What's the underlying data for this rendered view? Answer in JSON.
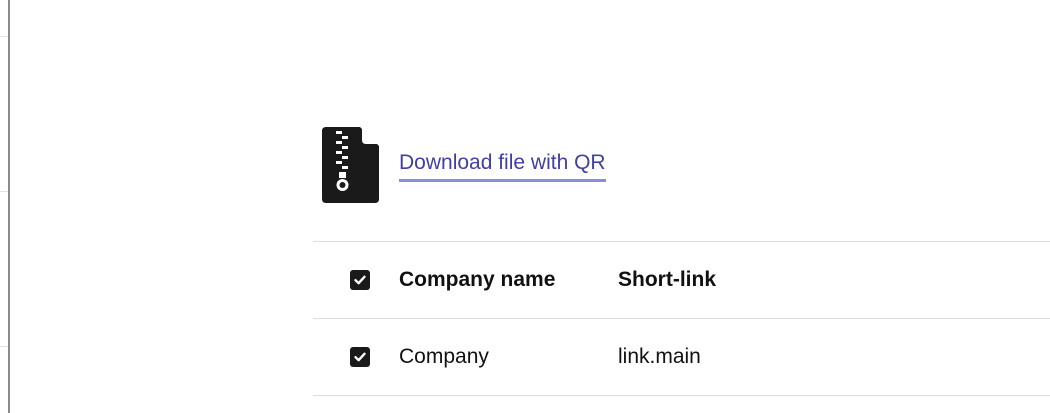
{
  "download": {
    "icon": "zip-file-icon",
    "link_label": "Download file with QR"
  },
  "table": {
    "columns": [
      "Company name",
      "Short-link"
    ],
    "header_checked": true,
    "rows": [
      {
        "checked": true,
        "company_name": "Company",
        "short_link": "link.main"
      }
    ]
  },
  "colors": {
    "link": "#3f3fa6",
    "link_underline": "#8c8cdf",
    "checkbox": "#1a1a1a",
    "divider": "#dddddd"
  }
}
